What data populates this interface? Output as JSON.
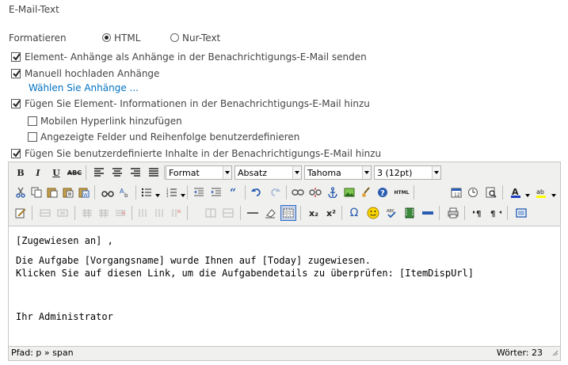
{
  "section_title": "E-Mail-Text",
  "format": {
    "label": "Formatieren",
    "options": [
      {
        "label": "HTML",
        "selected": true
      },
      {
        "label": "Nur-Text",
        "selected": false
      }
    ]
  },
  "checkboxes": [
    {
      "label": "Element- Anhänge als Anhänge in der Benachrichtigungs-E-Mail senden",
      "checked": true
    },
    {
      "label": "Manuell hochladen Anhänge",
      "checked": true
    },
    {
      "label": "Fügen Sie Element- Informationen in der Benachrichtigungs-E-Mail hinzu",
      "checked": true
    },
    {
      "label": "Mobilen Hyperlink hinzufügen",
      "checked": false
    },
    {
      "label": "Angezeigte Felder und Reihenfolge benutzerdefinieren",
      "checked": false
    },
    {
      "label": "Fügen Sie benutzerdefinierte Inhalte in der Benachrichtigungs-E-Mail hinzu",
      "checked": true
    }
  ],
  "attachments_link": "Wählen Sie Anhänge ...",
  "toolbar": {
    "format_select": "Format",
    "paragraph_select": "Absatz",
    "font_select": "Tahoma",
    "size_select": "3 (12pt)",
    "bold": "B",
    "italic": "I",
    "underline": "U",
    "strike": "ABC",
    "subscript": "x₂",
    "superscript": "x²",
    "omega": "Ω",
    "html": "HTML",
    "color_accent": "#2a5db0",
    "highlight_color": "#ffff00",
    "font_color": "#1f3fbf"
  },
  "content_lines": [
    "[Zugewiesen an] ,",
    "Die Aufgabe [Vorgangsname] wurde Ihnen auf [Today] zugewiesen.",
    "Klicken Sie auf diesen Link, um die Aufgabendetails zu überprüfen: [ItemDispUrl]",
    "Ihr Administrator"
  ],
  "status": {
    "path": "Pfad: p » span",
    "words": "Wörter: 23"
  }
}
